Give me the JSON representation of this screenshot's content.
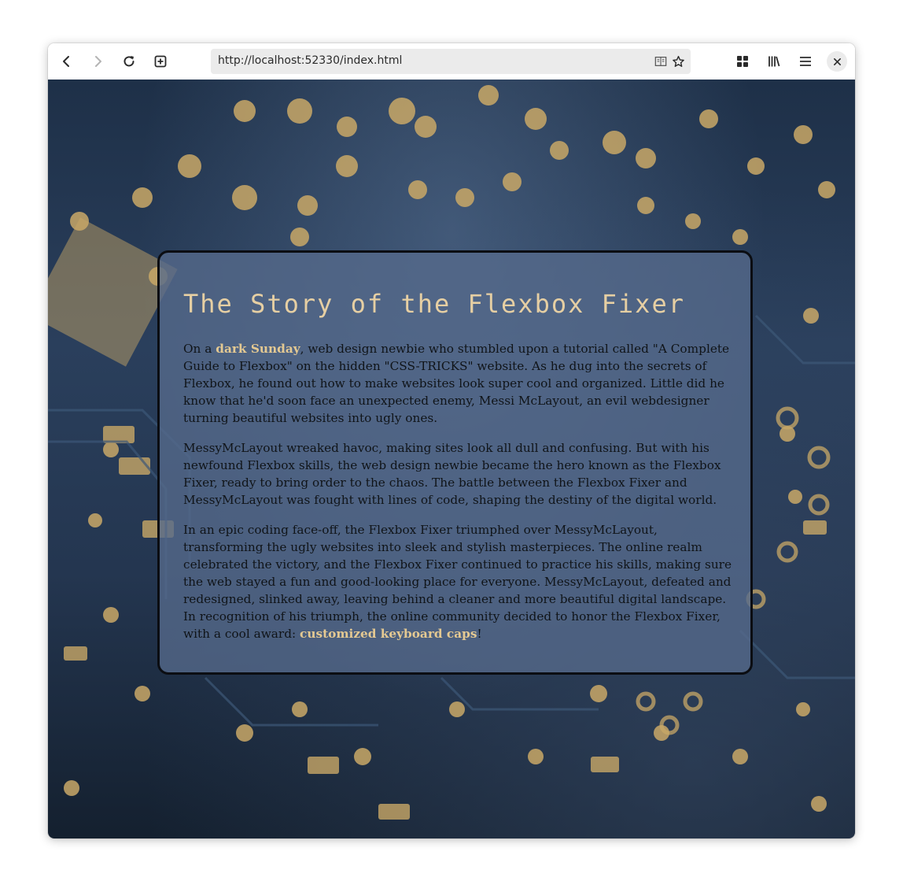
{
  "browser": {
    "url": "http://localhost:52330/index.html"
  },
  "page": {
    "title": "The Story of the Flexbox Fixer",
    "paragraphs": [
      {
        "before": "On a ",
        "link": "dark Sunday",
        "after": ", web design newbie who stumbled upon a tutorial called \"A Complete Guide to Flexbox\" on the hidden \"CSS-TRICKS\" website. As he dug into the secrets of Flexbox, he found out how to make websites look super cool and organized. Little did he know that he'd soon face an unexpected enemy, Messi McLayout, an evil webdesigner turning beautiful websites into ugly ones."
      },
      {
        "text": "MessyMcLayout wreaked havoc, making sites look all dull and confusing. But with his newfound Flexbox skills, the web design newbie became the hero known as the Flexbox Fixer, ready to bring order to the chaos. The battle between the Flexbox Fixer and MessyMcLayout was fought with lines of code, shaping the destiny of the digital world."
      },
      {
        "before": "In an epic coding face-off, the Flexbox Fixer triumphed over MessyMcLayout, transforming the ugly websites into sleek and stylish masterpieces. The online realm celebrated the victory, and the Flexbox Fixer continued to practice his skills, making sure the web stayed a fun and good-looking place for everyone. MessyMcLayout, defeated and redesigned, slinked away, leaving behind a cleaner and more beautiful digital landscape. In recognition of his triumph, the online community decided to honor the Flexbox Fixer, with a cool award: ",
        "link": "customized keyboard caps",
        "after": "!"
      }
    ]
  },
  "icons": {
    "back": "back-arrow-icon",
    "forward": "forward-arrow-icon",
    "reload": "reload-icon",
    "new_tab": "new-tab-icon",
    "reader": "reader-view-icon",
    "bookmark": "bookmark-star-icon",
    "extensions": "grid-icon",
    "library": "library-icon",
    "menu": "hamburger-menu-icon",
    "close": "close-icon"
  },
  "colors": {
    "link": "#e4c992",
    "title": "#e6cfa3",
    "card_bg": "#566a8c",
    "card_border": "#0b0d12"
  }
}
